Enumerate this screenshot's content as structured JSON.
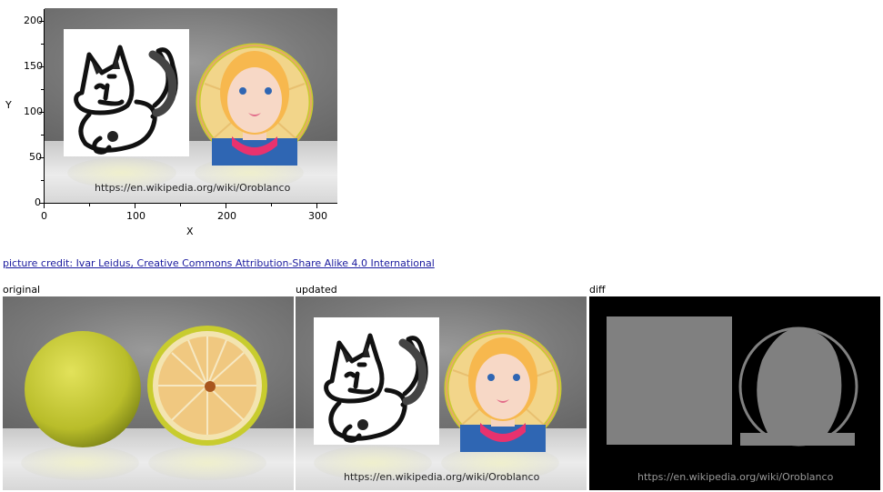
{
  "plot": {
    "y_axis_label": "Y",
    "x_axis_label": "X",
    "y_ticks": [
      "200",
      "150",
      "100",
      "50",
      "0"
    ],
    "x_ticks": [
      "0",
      "100",
      "200",
      "300"
    ],
    "image_caption": "https://en.wikipedia.org/wiki/Oroblanco"
  },
  "credit": {
    "text": "picture credit: Ivar Leidus, Creative Commons Attribution-Share Alike 4.0 International"
  },
  "panels": {
    "original_label": "original",
    "updated_label": "updated",
    "diff_label": "diff",
    "updated_caption": "https://en.wikipedia.org/wiki/Oroblanco",
    "diff_caption": "https://en.wikipedia.org/wiki/Oroblanco"
  },
  "colors": {
    "link": "#1a1a9e",
    "diff_background": "#000000",
    "diff_region": "#808080",
    "fruit_peel": "#c8cc2e",
    "fruit_flesh": "#f2d58a"
  },
  "icons": [
    "cat-doodle-icon",
    "woman-avatar-icon"
  ]
}
